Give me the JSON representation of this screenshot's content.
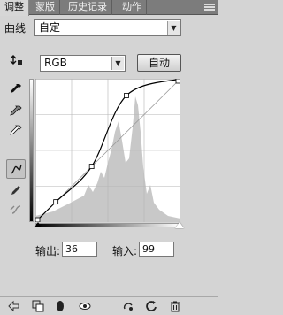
{
  "tabs": [
    {
      "label": "调整",
      "active": true
    },
    {
      "label": "蒙版",
      "active": false
    },
    {
      "label": "历史记录",
      "active": false
    },
    {
      "label": "动作",
      "active": false
    }
  ],
  "preset": {
    "label": "曲线",
    "value": "自定"
  },
  "channel": {
    "value": "RGB"
  },
  "auto_label": "自动",
  "curve": {
    "points": [
      [
        0,
        0
      ],
      [
        36,
        36
      ],
      [
        99,
        99
      ],
      [
        160,
        225
      ],
      [
        255,
        255
      ]
    ]
  },
  "output": {
    "label": "输出:",
    "value": "36"
  },
  "input": {
    "label": "输入:",
    "value": "99"
  },
  "colors": {
    "background": "#d4d4d4",
    "tab_bar": "#7c7c7c",
    "graph_bg": "#ffffff",
    "histogram": "#c8c8c8",
    "curve": "#000000"
  },
  "tools": [
    "target-adjust-icon",
    "black-point-eyedropper-icon",
    "gray-point-eyedropper-icon",
    "white-point-eyedropper-icon",
    "curve-points-icon",
    "pencil-icon",
    "smooth-icon"
  ],
  "bottom_icons": [
    "back-arrow-icon",
    "clip-layer-icon",
    "eye-mask-icon",
    "visibility-eye-icon",
    "previous-state-icon",
    "reset-icon",
    "delete-icon"
  ]
}
